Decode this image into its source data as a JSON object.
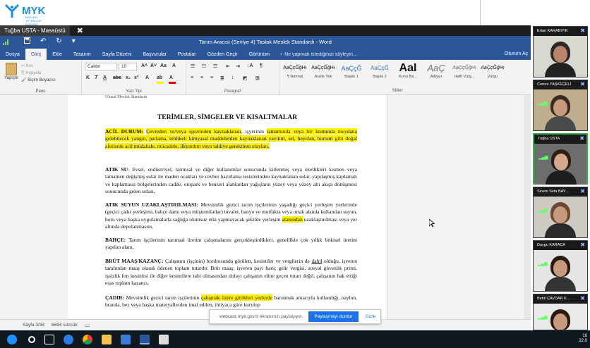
{
  "logo": {
    "brand": "MYK",
    "subtitle": "MESLEKİ YETERLİLİK KURUMU"
  },
  "share_tab": {
    "title": "Tuğba USTA - Masaüstü",
    "close": "✖"
  },
  "word": {
    "title": "Tarım Aracısı (Seviye 4) Taslak Meslek Standardı  -  Word",
    "tabs": [
      "Dosya",
      "Giriş",
      "Ekle",
      "Tasarım",
      "Sayfa Düzeni",
      "Başvurular",
      "Postalar",
      "Gözden Geçir",
      "Görünüm"
    ],
    "tell_me": "♀ Ne yapmak istediğinizi söyleyin...",
    "user": "Oturum Aç",
    "ribbon": {
      "paste": "Yapıştır",
      "cut": "Kes",
      "copy": "Kopyala",
      "format_painter": "Biçim Boyacısı",
      "group_clipboard": "Pano",
      "font_name": "Calibri",
      "font_size": "10",
      "group_font": "Yazı Tipi",
      "group_paragraph": "Paragraf",
      "group_styles": "Stiller",
      "styles": [
        {
          "preview": "AaÇçĞğHı",
          "name": "¶ Normal"
        },
        {
          "preview": "AaÇçĞğHı",
          "name": "Aralık Yok"
        },
        {
          "preview": "AaÇçĞ",
          "name": "Başlık 1"
        },
        {
          "preview": "AaÇçĞ",
          "name": "Başlık 2"
        },
        {
          "preview": "AaI",
          "name": "Konu Ba..."
        },
        {
          "preview": "AaÇ",
          "name": "Altyazı"
        },
        {
          "preview": "AaÇçĞğHı",
          "name": "Hafif Vurg..."
        },
        {
          "preview": "AaÇçĞğHı",
          "name": "Vurgu"
        }
      ]
    },
    "status": {
      "page": "Sayfa 3/34",
      "words": "6594 sözcük"
    }
  },
  "document": {
    "running_header": "Ulusal Meslek Standardı",
    "heading": "TERİMLER, SİMGELER VE KISALTMALAR",
    "entries": [
      {
        "term": "ACİL DURUM:",
        "seg1": "Çevreden ve/veya işyerinden kaynaklanan",
        "seg2": ", işyerinin ",
        "seg3": "tamamında veya bir kısmında meydana gelebilecek yangın, patlama, tehlikeli kimyasal maddelerden kaynaklanan yayılım, sel, heyelan, hortum gibi doğal afetlerde acil müdahale, mücadele, ilkyardım veya tahliye gerektiren olayları,"
      },
      {
        "term": "ATIK SU",
        "text": ": Evsel, endüstriyel, tarımsal ve diğer kullanımlar sonucunda kirlenmiş veya özellikleri kısmen veya tamamen değişmiş sular ile maden ocakları ve cevher hazırlama tesislerinden kaynaklanan sular, yapılaşmış kaplamalı ve kaplamasız bölgelerinden cadde, otopark ve benzeri alanlardan yağışların yüzey veya yüzey altı akışa dönüşmesi sonucunda gelen suları,"
      },
      {
        "term": "ATIK SUYUN UZAKLAŞTIRILMASI:",
        "text1": " Mevsimlik gezici tarım işçilerinin yaşadığı geçici yerleşim yerlerinde (geçici çadır yerleşimi, bahçe damı veya müştemilatlar) tuvalet, banyo ve mutfakta veya ortak alanda kullanılan suyun, boru veya başka uygulamalarla sağlığa olumsuz etki yapmayacak şekilde yerleşim ",
        "highlight": "alanından",
        "text2": " uzaklaştırılması veya yer altında depolanmasını,"
      },
      {
        "term": "BAHÇE:",
        "text": " Tarım işçilerinin tarımsal üretim çalışmalarını gerçekleştirdikleri, genellikle çok yıllık bitkisel üretim yapılan alanı,"
      },
      {
        "term": "BRÜT MAAŞ/KAZANÇ:",
        "text1": " Çalışanın (işçinin) bordrosunda görülen, kesintiler ve vergilerin de ",
        "underline": "dahil",
        "text2": " olduğu, işveren tarafından maaş olarak ödenen toplam tutardır. Brüt maaş; işveren payı hariç gelir vergisi, sosyal güvenlik primi, işsizlik fon kesintisi ile diğer kesintilere tabi olmasından dolayı çalışanın eline geçen tutarı değil, çalışanın hak ettiği esas toplam kazancı,"
      },
      {
        "term": "ÇADIR:",
        "text1": " Mevsimlik gezici tarım işçilerinin ",
        "highlight": "çalışmak üzere gittikleri yerlerde",
        "text2": " barınmak amacıyla kullandığı, naylon, branda, bez veya başka materyallerden imal edilen, ihtiyaca göre kurulup"
      }
    ]
  },
  "notification": {
    "text": "webcast.myk.gov.tr ekranınızı paylaşıyor.",
    "stop_button": "Paylaşmayı durdur",
    "hide": "Gizle"
  },
  "participants": [
    {
      "name": "Ertan KARABIYIK",
      "active": false
    },
    {
      "name": "Cemre YAŞKEÇELİ",
      "active": false
    },
    {
      "name": "Tuğba USTA",
      "active": true
    },
    {
      "name": "Sinem Sefa BAY...",
      "active": false
    },
    {
      "name": "Duygu KARACA",
      "active": false
    },
    {
      "name": "Betül ÇAVDAR K...",
      "active": false
    }
  ],
  "taskbar": {
    "time": "16",
    "date": "22.0"
  },
  "colors": {
    "word_blue": "#2b579a",
    "highlight": "#fff000",
    "active_border": "#33b04a",
    "stop_button": "#1a73e8"
  }
}
